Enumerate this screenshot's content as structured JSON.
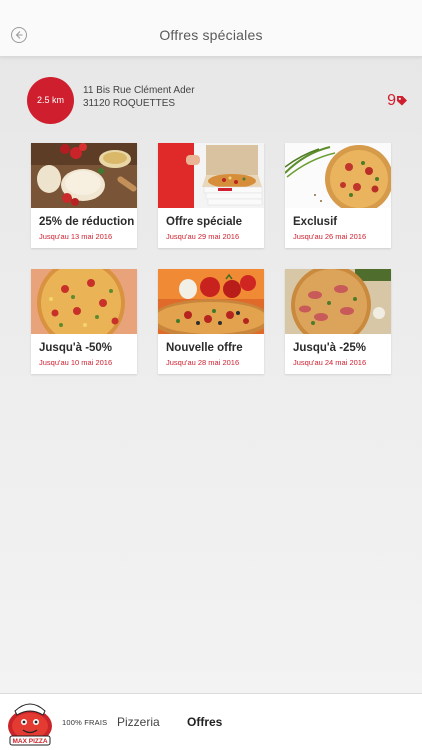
{
  "header": {
    "title": "Offres spéciales",
    "back_icon": "back-arrow-icon"
  },
  "location": {
    "distance": "2.5 km",
    "address_line1": "11 Bis Rue Clément Ader",
    "address_line2": "31120 ROQUETTES",
    "offer_count": "9",
    "tag_icon": "tag-icon"
  },
  "offers": [
    {
      "title": "25% de réduction",
      "date": "Jusqu'au 13 mai 2016",
      "image": "pizza-dough-photo"
    },
    {
      "title": "Offre spéciale",
      "date": "Jusqu'au 29 mai 2016",
      "image": "pizza-delivery-box-photo"
    },
    {
      "title": "Exclusif",
      "date": "Jusqu'au 26 mai 2016",
      "image": "pizza-herbs-photo"
    },
    {
      "title": "Jusqu'à -50%",
      "date": "Jusqu'au 10 mai 2016",
      "image": "pizza-peppers-photo"
    },
    {
      "title": "Nouvelle offre",
      "date": "Jusqu'au 28 mai 2016",
      "image": "pizza-tomatoes-photo"
    },
    {
      "title": "Jusqu'à -25%",
      "date": "Jusqu'au 24 mai 2016",
      "image": "pizza-ham-photo"
    }
  ],
  "bottom_nav": {
    "logo_text": "MAX PIZZA",
    "tagline": "100% FRAIS",
    "items": [
      {
        "label": "Pizzeria",
        "active": false
      },
      {
        "label": "Offres",
        "active": true
      }
    ]
  },
  "colors": {
    "accent": "#cf1f2e",
    "background": "#ececec",
    "card": "#ffffff"
  }
}
